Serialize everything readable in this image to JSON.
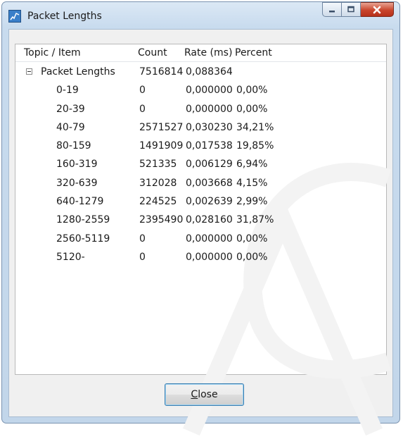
{
  "window": {
    "title": "Packet Lengths",
    "icon": "graph-app-icon",
    "caption_icons": [
      "minimize-icon",
      "maximize-icon",
      "close-icon"
    ]
  },
  "table": {
    "headers": {
      "topic": "Topic / Item",
      "count": "Count",
      "rate": "Rate (ms)",
      "percent": "Percent"
    },
    "parent": {
      "topic": "Packet Lengths",
      "count": "7516814",
      "rate": "0,088364",
      "percent": "",
      "expander_icon": "collapse-minus-icon"
    },
    "rows": [
      {
        "topic": "0-19",
        "count": "0",
        "rate": "0,000000",
        "percent": "0,00%"
      },
      {
        "topic": "20-39",
        "count": "0",
        "rate": "0,000000",
        "percent": "0,00%"
      },
      {
        "topic": "40-79",
        "count": "2571527",
        "rate": "0,030230",
        "percent": "34,21%"
      },
      {
        "topic": "80-159",
        "count": "1491909",
        "rate": "0,017538",
        "percent": "19,85%"
      },
      {
        "topic": "160-319",
        "count": "521335",
        "rate": "0,006129",
        "percent": "6,94%"
      },
      {
        "topic": "320-639",
        "count": "312028",
        "rate": "0,003668",
        "percent": "4,15%"
      },
      {
        "topic": "640-1279",
        "count": "224525",
        "rate": "0,002639",
        "percent": "2,99%"
      },
      {
        "topic": "1280-2559",
        "count": "2395490",
        "rate": "0,028160",
        "percent": "31,87%"
      },
      {
        "topic": "2560-5119",
        "count": "0",
        "rate": "0,000000",
        "percent": "0,00%"
      },
      {
        "topic": "5120-",
        "count": "0",
        "rate": "0,000000",
        "percent": "0,00%"
      }
    ]
  },
  "buttons": {
    "close_mnemonic": "C",
    "close_rest": "lose"
  },
  "colors": {
    "accent": "#3c7fb1",
    "titlebar": "#c8dbee",
    "close_caption": "#c9452c"
  }
}
